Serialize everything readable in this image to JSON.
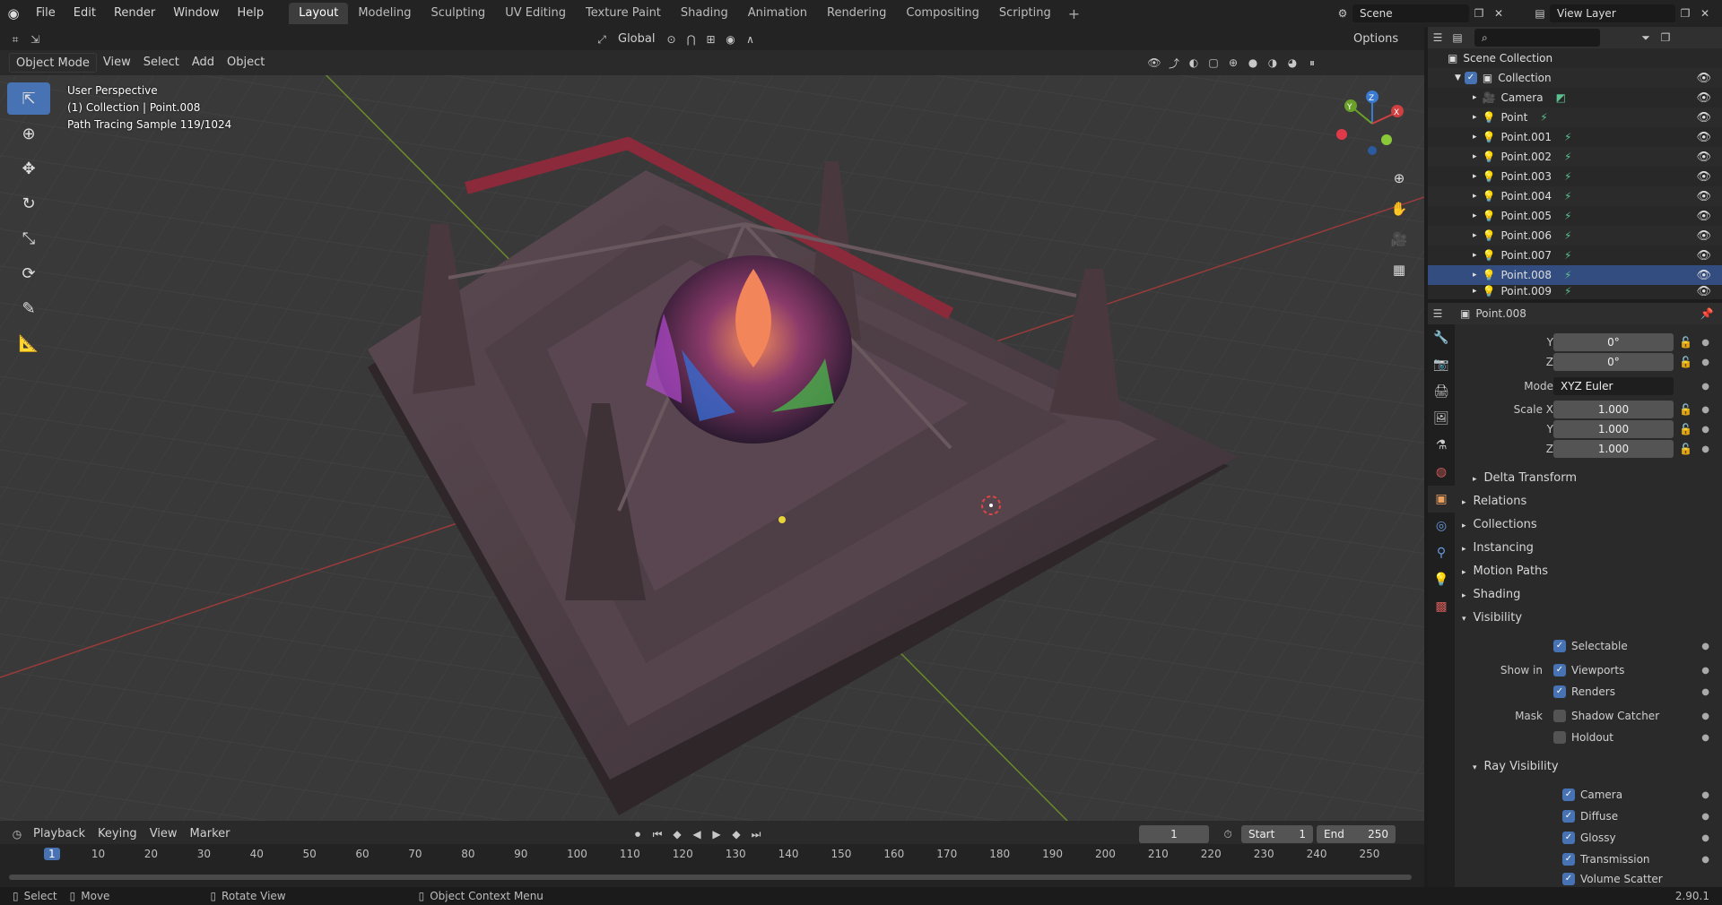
{
  "topbar": {
    "menus": [
      "File",
      "Edit",
      "Render",
      "Window",
      "Help"
    ],
    "tabs": [
      "Layout",
      "Modeling",
      "Sculpting",
      "UV Editing",
      "Texture Paint",
      "Shading",
      "Animation",
      "Rendering",
      "Compositing",
      "Scripting"
    ],
    "active_tab": "Layout",
    "scene": "Scene",
    "view_layer": "View Layer"
  },
  "viewport_header": {
    "mode": "Object Mode",
    "menus": [
      "View",
      "Select",
      "Add",
      "Object"
    ],
    "transform_orientation": "Global",
    "options": "Options"
  },
  "overlay": {
    "line1": "User Perspective",
    "line2": "(1) Collection | Point.008",
    "line3": "Path Tracing Sample 119/1024"
  },
  "gizmo": {
    "x": "X",
    "y": "Y",
    "z": "Z"
  },
  "outliner": {
    "scene_collection": "Scene Collection",
    "collection": "Collection",
    "items": [
      "Camera",
      "Point",
      "Point.001",
      "Point.002",
      "Point.003",
      "Point.004",
      "Point.005",
      "Point.006",
      "Point.007",
      "Point.008",
      "Point.009"
    ],
    "selected": "Point.008"
  },
  "properties": {
    "object_name": "Point.008",
    "rotation_y_label": "Y",
    "rotation_y": "0°",
    "rotation_z_label": "Z",
    "rotation_z": "0°",
    "mode_label": "Mode",
    "mode": "XYZ Euler",
    "scale_x_label": "Scale X",
    "scale_x": "1.000",
    "scale_y_label": "Y",
    "scale_y": "1.000",
    "scale_z_label": "Z",
    "scale_z": "1.000",
    "panels": [
      "Delta Transform",
      "Relations",
      "Collections",
      "Instancing",
      "Motion Paths",
      "Shading",
      "Visibility"
    ],
    "selectable": "Selectable",
    "show_in_label": "Show in",
    "viewports": "Viewports",
    "renders": "Renders",
    "mask_label": "Mask",
    "shadow_catcher": "Shadow Catcher",
    "holdout": "Holdout",
    "ray_visibility": "Ray Visibility",
    "ray_items": [
      "Camera",
      "Diffuse",
      "Glossy",
      "Transmission",
      "Volume Scatter"
    ]
  },
  "timeline": {
    "menus": [
      "Playback",
      "Keying",
      "View",
      "Marker"
    ],
    "current_frame": "1",
    "start_label": "Start",
    "start": "1",
    "end_label": "End",
    "end": "250",
    "ticks": [
      "1",
      "10",
      "20",
      "30",
      "40",
      "50",
      "60",
      "70",
      "80",
      "90",
      "100",
      "110",
      "120",
      "130",
      "140",
      "150",
      "160",
      "170",
      "180",
      "190",
      "200",
      "210",
      "220",
      "230",
      "240",
      "250"
    ]
  },
  "statusbar": {
    "select": "Select",
    "move": "Move",
    "rotate": "Rotate View",
    "context": "Object Context Menu",
    "version": "2.90.1"
  }
}
